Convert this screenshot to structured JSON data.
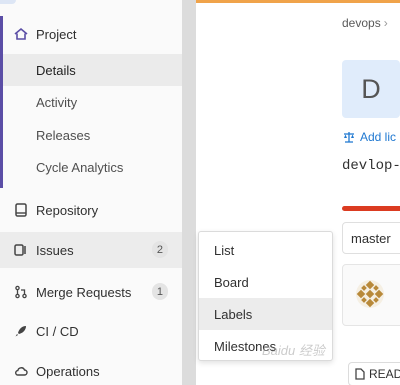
{
  "sidebar": {
    "project": {
      "label": "Project",
      "icon": "home-icon"
    },
    "project_items": [
      {
        "label": "Details",
        "active": true
      },
      {
        "label": "Activity"
      },
      {
        "label": "Releases"
      },
      {
        "label": "Cycle Analytics"
      }
    ],
    "items": [
      {
        "label": "Repository",
        "icon": "book-icon"
      },
      {
        "label": "Issues",
        "icon": "issues-icon",
        "badge": "2"
      },
      {
        "label": "Merge Requests",
        "icon": "merge-request-icon",
        "badge": "1"
      },
      {
        "label": "CI / CD",
        "icon": "rocket-icon"
      },
      {
        "label": "Operations",
        "icon": "cloud-icon"
      }
    ]
  },
  "main": {
    "breadcrumb": {
      "first": "devops",
      "separator": "›"
    },
    "avatar_letter": "D",
    "license_link": "Add lic",
    "project_name": "devlop-p",
    "branch": "master",
    "readme_label": "READ"
  },
  "issues_dropdown": {
    "items": [
      "List",
      "Board",
      "Labels",
      "Milestones"
    ],
    "hovered": "Labels"
  },
  "watermark": "Baidu 经验",
  "colors": {
    "accent": "#5b4ea6",
    "link": "#1f78d1",
    "top_bar": "#f0a34a",
    "progress_red": "#db3b21"
  }
}
